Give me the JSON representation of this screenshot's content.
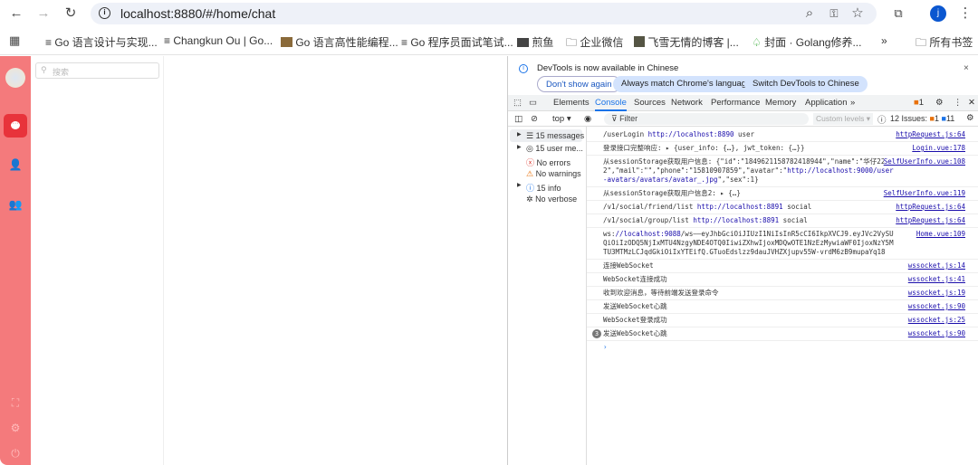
{
  "browser": {
    "url": "localhost:8880/#/home/chat",
    "profile_initial": "j",
    "bookmarks": [
      "Go 语言设计与实现...",
      "Changkun Ou | Go...",
      "Go 语言高性能编程...",
      "Go 程序员面试笔试...",
      "煎鱼",
      "企业微信",
      "飞雪无情的博客 |...",
      "封面 · Golang修养...",
      "所有书签"
    ]
  },
  "app": {
    "search_placeholder": "搜索",
    "sidebar_color": "#f47a7c",
    "active_color": "#e8333b"
  },
  "devtools": {
    "banner": {
      "text": "DevTools is now available in Chinese",
      "buttons": [
        "Don't show again",
        "Always match Chrome's language",
        "Switch DevTools to Chinese"
      ]
    },
    "tabs": [
      "Elements",
      "Console",
      "Sources",
      "Network",
      "Performance",
      "Memory",
      "Application"
    ],
    "active_tab": "Console",
    "error_badge": "1",
    "toolbar": {
      "context": "top",
      "filter_placeholder": "Filter",
      "levels": "Custom levels",
      "issues_label": "12 Issues:",
      "issues_errors": "1",
      "issues_info": "11"
    },
    "sidebar": [
      "15 messages",
      "15 user me...",
      "No errors",
      "No warnings",
      "15 info",
      "No verbose"
    ],
    "logs": [
      {
        "text": "/userLogin ",
        "link": "http://localhost:8890",
        "after": " user",
        "src": "httpRequest.js:64"
      },
      {
        "text": "登录接口完整响应:  ▸ {user_info: {…}, jwt_token: {…}}",
        "src": "Login.vue:178"
      },
      {
        "text": "从sessionStorage获取用户信息: {\"id\":\"1849621158782418944\",\"name\":\"华仔222\",\"mail\":\"\",\"phone\":\"15810907859\",\"avatar\":\"",
        "link": "http://localhost:9000/user-avatars/avatars/avatar_.jpg",
        "after": "\",\"sex\":1}",
        "src": "SelfUserInfo.vue:108"
      },
      {
        "text": "从sessionStorage获取用户信息2:  ▸ {…}",
        "src": "SelfUserInfo.vue:119"
      },
      {
        "text": "/v1/social/friend/list ",
        "link": "http://localhost:8891",
        "after": " social",
        "src": "httpRequest.js:64"
      },
      {
        "text": "/v1/social/group/list ",
        "link": "http://localhost:8891",
        "after": " social",
        "src": "httpRequest.js:64"
      },
      {
        "text": "ws:",
        "link": "//localhost:9088",
        "after": "/ws——eyJhbGciOiJIUzI1NiIsInR5cCI6IkpXVCJ9.eyJVc2VySUQiOiIzODQ5NjIxMTU4NzgyNDE4OTQ0IiwiZXhwIjoxMDQwOTE1NzEzMywiaWF0IjoxNzY5MTU3MTMzLCJqdGkiOiIxYTEifQ.GTuoEdslzz9dauJVHZXjupv55W-vrdM6zB9mupaYq18",
        "src": "Home.vue:109"
      },
      {
        "text": "连接WebSocket",
        "src": "wssocket.js:14"
      },
      {
        "text": "WebSocket连接成功",
        "src": "wssocket.js:41"
      },
      {
        "text": "收到欢迎消息，等待前端发送登录命令",
        "src": "wssocket.js:19"
      },
      {
        "text": "发送WebSocket心跳",
        "src": "wssocket.js:90"
      },
      {
        "text": "WebSocket登录成功",
        "src": "wssocket.js:25"
      },
      {
        "text": "发送WebSocket心跳",
        "src": "wssocket.js:90",
        "repeat": "3"
      }
    ],
    "prompt": "›"
  }
}
